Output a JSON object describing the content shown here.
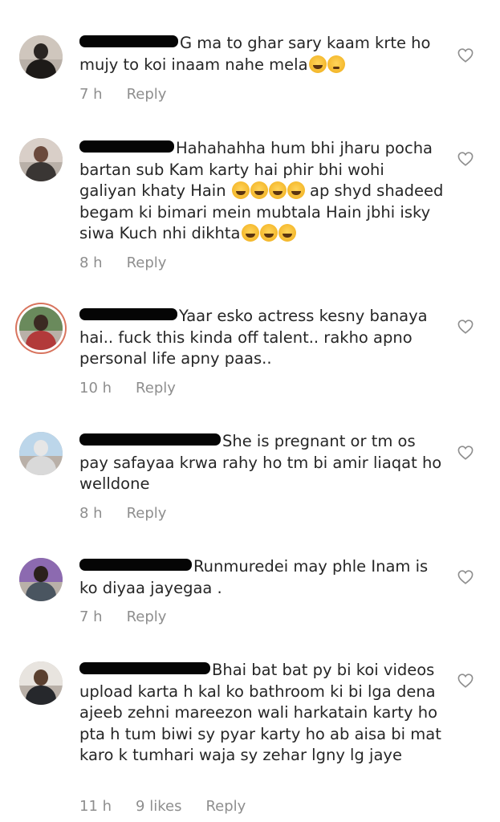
{
  "comments": [
    {
      "text": "G ma to ghar sary kaam krte ho mujy to koi inaam nahe mela",
      "time": "7 h",
      "likes": "",
      "reply": "Reply",
      "avatar_colors": {
        "sky": "#cfc6bd",
        "head": "#2a2522",
        "body": "#1d1a18"
      }
    },
    {
      "text": "Hahahahha hum bhi jharu pocha bartan sub Kam karty hai phir bhi wohi galiyan khaty Hain",
      "text2": " ap shyd shadeed begam ki bimari mein mubtala Hain jbhi isky siwa Kuch nhi dikhta",
      "time": "8 h",
      "likes": "",
      "reply": "Reply",
      "avatar_colors": {
        "sky": "#d9cfc8",
        "head": "#6b4a3c",
        "body": "#3a3634"
      }
    },
    {
      "text": "Yaar esko actress kesny banaya hai.. fuck this kinda off talent.. rakho apno personal life apny paas..",
      "time": "10 h",
      "likes": "",
      "reply": "Reply",
      "avatar_colors": {
        "sky": "#6a8a5c",
        "head": "#3b2a22",
        "body": "#b23a3a"
      }
    },
    {
      "text": "She is pregnant or tm os pay safayaa krwa rahy ho tm bi amir liaqat ho welldone",
      "time": "8 h",
      "likes": "",
      "reply": "Reply",
      "avatar_colors": {
        "sky": "#bcd6ea",
        "head": "#e6e6e6",
        "body": "#d9d9d9"
      }
    },
    {
      "text": "Runmuredei may phle Inam is ko diyaa jayegaa .",
      "time": "7 h",
      "likes": "",
      "reply": "Reply",
      "avatar_colors": {
        "sky": "#8c6ab0",
        "head": "#2b211c",
        "body": "#4a5560"
      }
    },
    {
      "text": "Bhai bat bat py bi koi videos upload karta h kal ko bathroom ki bi lga dena ajeeb zehni mareezon wali harkatain karty ho pta h tum biwi sy pyar karty ho ab aisa bi mat karo k tumhari waja sy zehar lgny lg jaye",
      "time": "11 h",
      "likes": "9 likes",
      "reply": "Reply",
      "avatar_colors": {
        "sky": "#e8e4df",
        "head": "#5a4030",
        "body": "#26282c"
      }
    }
  ],
  "icons": {
    "like": "heart-outline-icon",
    "emoji_laugh": "grinning-squinting-face-emoji",
    "emoji_think": "thinking-face-emoji"
  },
  "colors": {
    "text": "#262626",
    "meta": "#8e8e8e",
    "redaction": "#050505",
    "story_ring": "#d8745e"
  }
}
